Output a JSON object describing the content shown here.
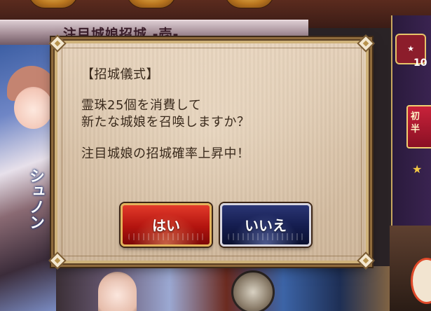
{
  "banner": {
    "title": "注目城娘招城 -壱-"
  },
  "side_panel": {
    "badge_text": "10",
    "promo_text": "初\n半"
  },
  "background": {
    "vertical_text": "シュノン"
  },
  "dialog": {
    "heading": "【招城儀式】",
    "line1": "霊珠25個を消費して",
    "line2": "新たな城娘を召喚しますか？",
    "line3": "注目城娘の招城確率上昇中！",
    "yes_label": "はい",
    "no_label": "いいえ"
  },
  "colors": {
    "yes_button": "#b3140f",
    "no_button": "#141c4e",
    "dialog_bg": "#d8c1a6",
    "text": "#3a2a1c"
  }
}
